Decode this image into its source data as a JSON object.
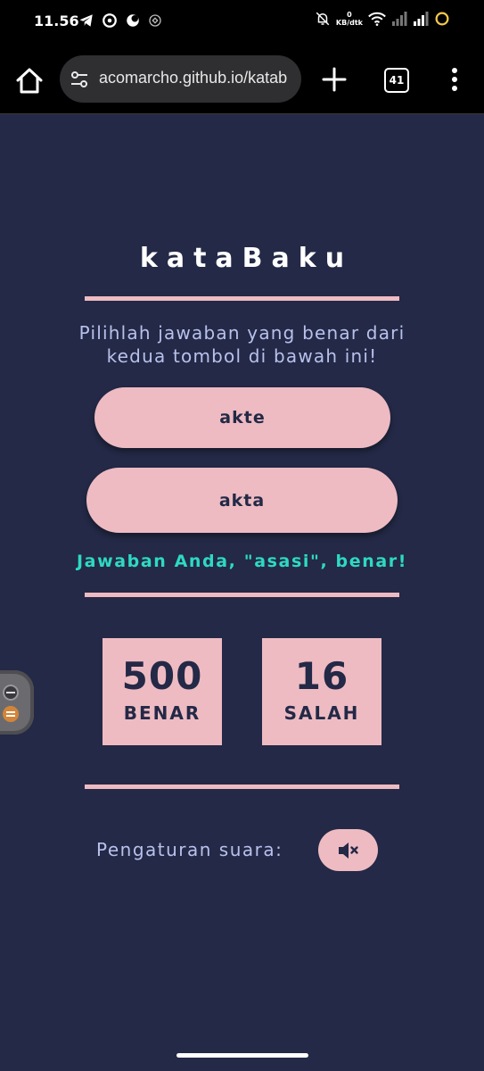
{
  "status_bar": {
    "time": "11.56",
    "net_speed_value": "0",
    "net_speed_unit": "KB/dtk"
  },
  "browser": {
    "url": "acomarcho.github.io/katab",
    "tab_count": "41"
  },
  "game": {
    "title": "kataBaku",
    "instruction_line1": "Pilihlah jawaban yang benar dari",
    "instruction_line2": "kedua tombol di bawah ini!",
    "option_1": "akte",
    "option_2": "akta",
    "feedback": "Jawaban Anda, \"asasi\", benar!",
    "correct_count": "500",
    "correct_label": "BENAR",
    "wrong_count": "16",
    "wrong_label": "SALAH",
    "sound_label": "Pengaturan suara:",
    "sound_icon": "volume-mute-icon"
  },
  "colors": {
    "background": "#232946",
    "accent": "#eebbc3",
    "instruction_text": "#b8c1ec",
    "feedback_text": "#2ed9c3",
    "button_text": "#232946"
  }
}
